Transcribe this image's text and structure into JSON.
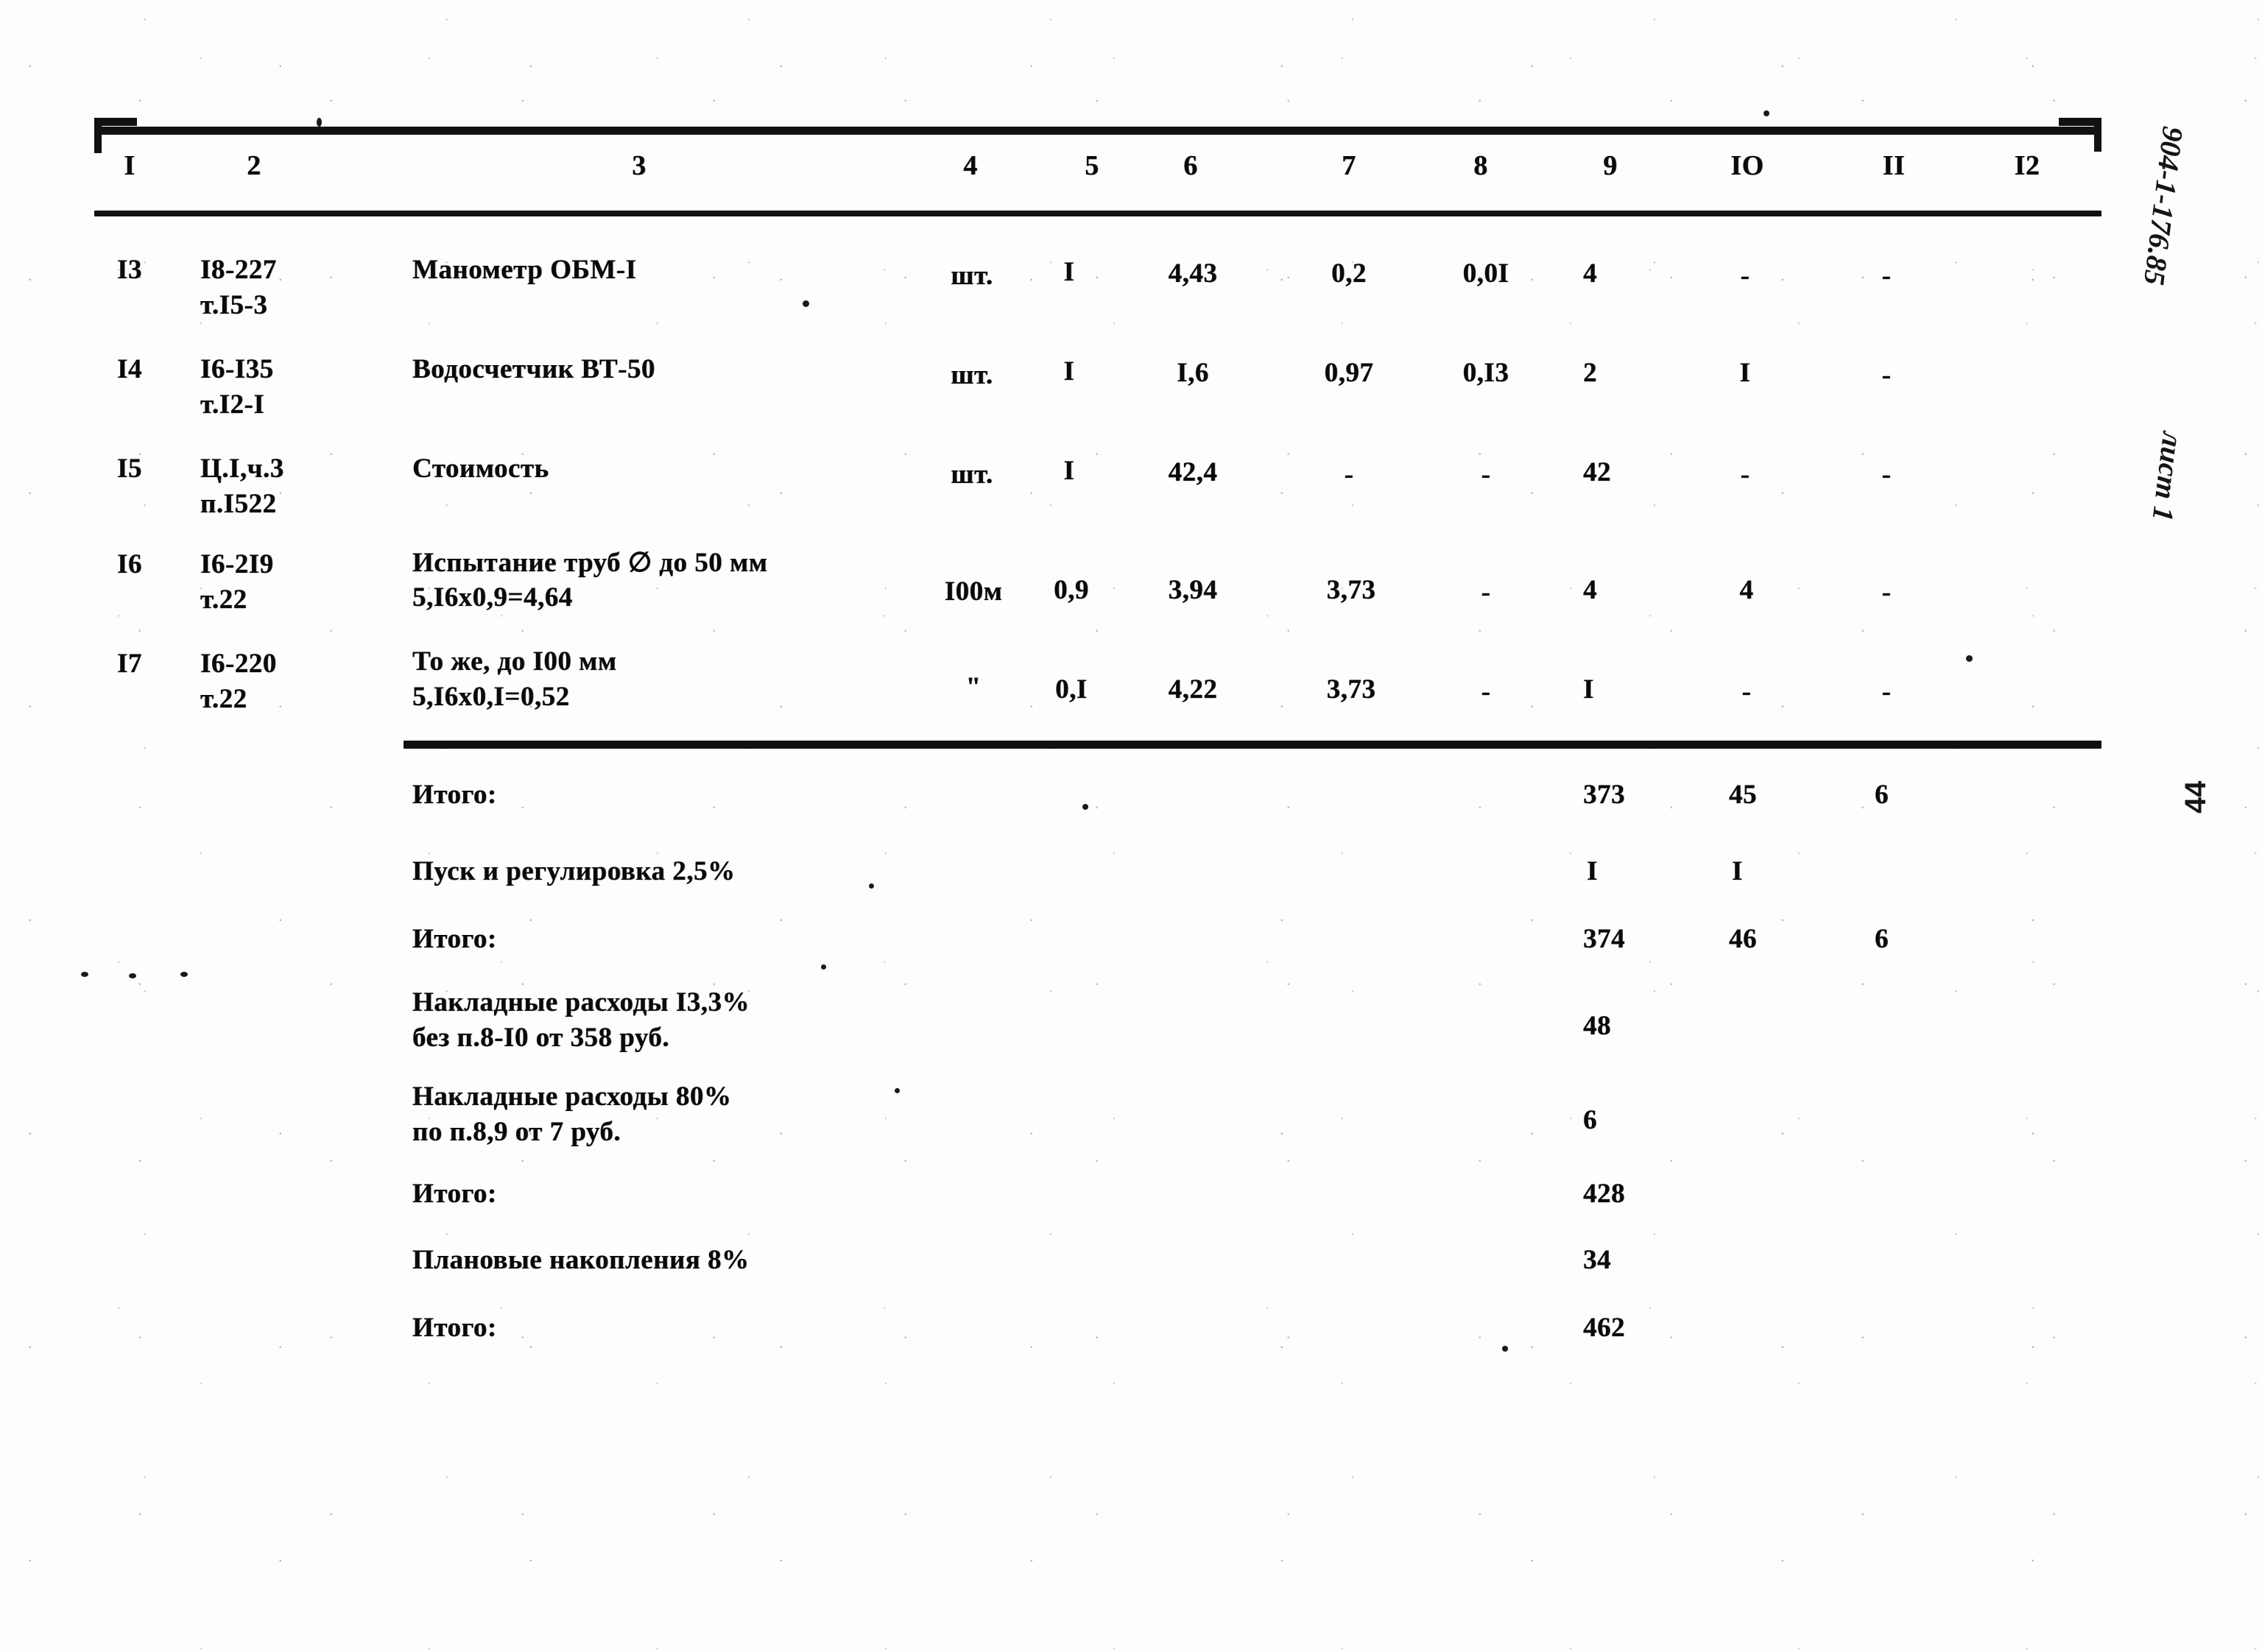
{
  "document": {
    "margin_code": "904-1-176.85",
    "margin_sheet": "лист 1",
    "page_number": "44"
  },
  "table": {
    "column_headers": [
      "I",
      "2",
      "3",
      "4",
      "5",
      "6",
      "7",
      "8",
      "9",
      "IO",
      "II",
      "I2"
    ],
    "rows": [
      {
        "num": "I3",
        "ref_line1": "I8-227",
        "ref_line2": "т.I5-3",
        "desc_line1": "Манометр ОБМ-I",
        "desc_line2": "",
        "unit": "шт.",
        "qty": "I",
        "c6": "4,43",
        "c7": "0,2",
        "c8": "0,0I",
        "c9": "4",
        "c10": "-",
        "c11": "-",
        "c12": ""
      },
      {
        "num": "I4",
        "ref_line1": "I6-I35",
        "ref_line2": "т.I2-I",
        "desc_line1": "Водосчетчик ВТ-50",
        "desc_line2": "",
        "unit": "шт.",
        "qty": "I",
        "c6": "I,6",
        "c7": "0,97",
        "c8": "0,I3",
        "c9": "2",
        "c10": "I",
        "c11": "-",
        "c12": ""
      },
      {
        "num": "I5",
        "ref_line1": "Ц.I,ч.3",
        "ref_line2": "п.I522",
        "desc_line1": "Стоимость",
        "desc_line2": "",
        "unit": "шт.",
        "qty": "I",
        "c6": "42,4",
        "c7": "-",
        "c8": "-",
        "c9": "42",
        "c10": "-",
        "c11": "-",
        "c12": ""
      },
      {
        "num": "I6",
        "ref_line1": "I6-2I9",
        "ref_line2": "т.22",
        "desc_line1": "Испытание труб ∅ до 50 мм",
        "desc_line2": "5,I6х0,9=4,64",
        "unit": "I00м",
        "qty": "0,9",
        "c6": "3,94",
        "c7": "3,73",
        "c8": "-",
        "c9": "4",
        "c10": "4",
        "c11": "-",
        "c12": ""
      },
      {
        "num": "I7",
        "ref_line1": "I6-220",
        "ref_line2": "т.22",
        "desc_line1": "То же, до I00 мм",
        "desc_line2": "5,I6х0,I=0,52",
        "unit": "\"",
        "qty": "0,I",
        "c6": "4,22",
        "c7": "3,73",
        "c8": "-",
        "c9": "I",
        "c10": "-",
        "c11": "-",
        "c12": ""
      }
    ],
    "summary": [
      {
        "label_line1": "Итого:",
        "label_line2": "",
        "c9": "373",
        "c10": "45",
        "c11": "6"
      },
      {
        "label_line1": "Пуск и регулировка 2,5%",
        "label_line2": "",
        "c9": "I",
        "c10": "I",
        "c11": ""
      },
      {
        "label_line1": "Итого:",
        "label_line2": "",
        "c9": "374",
        "c10": "46",
        "c11": "6"
      },
      {
        "label_line1": "Накладные расходы I3,3%",
        "label_line2": "без п.8-I0 от 358 руб.",
        "c9": "48",
        "c10": "",
        "c11": ""
      },
      {
        "label_line1": "Накладные расходы 80%",
        "label_line2": "по п.8,9 от 7 руб.",
        "c9": "6",
        "c10": "",
        "c11": ""
      },
      {
        "label_line1": "Итого:",
        "label_line2": "",
        "c9": "428",
        "c10": "",
        "c11": ""
      },
      {
        "label_line1": "Плановые накопления 8%",
        "label_line2": "",
        "c9": "34",
        "c10": "",
        "c11": ""
      },
      {
        "label_line1": "Итого:",
        "label_line2": "",
        "c9": "462",
        "c10": "",
        "c11": ""
      }
    ]
  }
}
